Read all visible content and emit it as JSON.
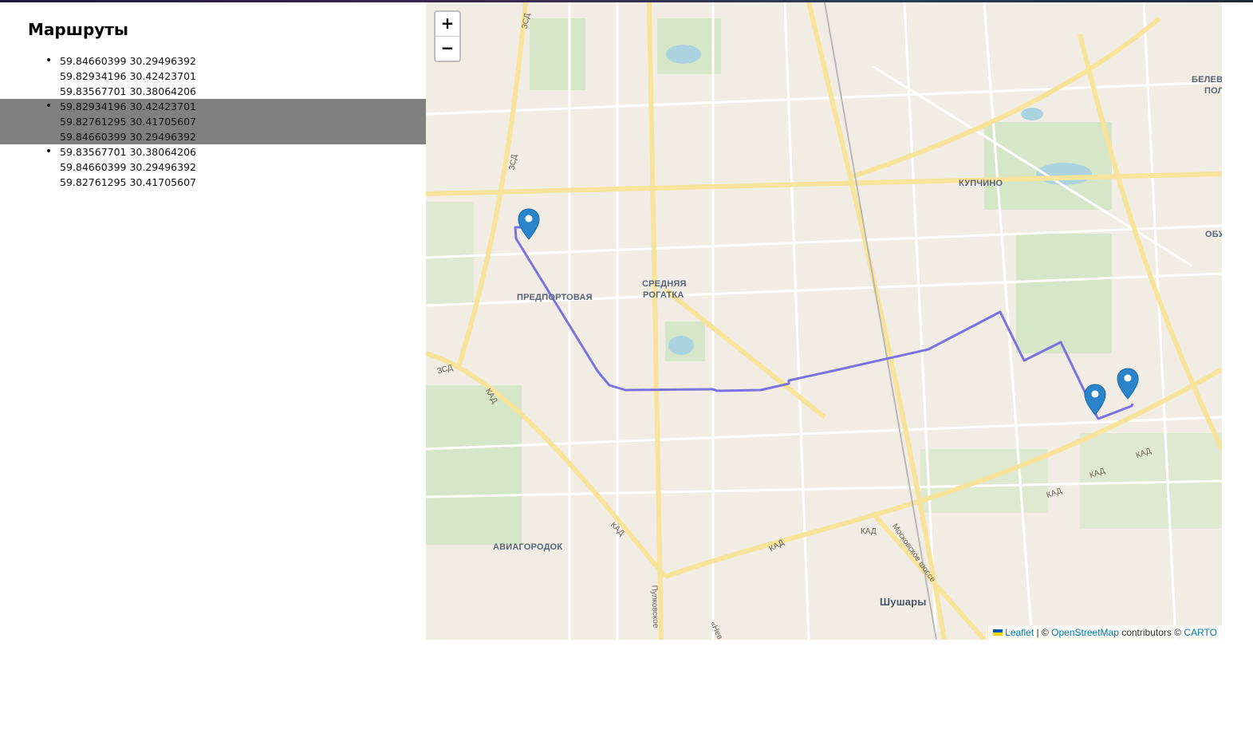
{
  "page": {
    "title": "Маршруты"
  },
  "routes": [
    {
      "points": [
        "59.84660399 30.29496392",
        "59.82934196 30.42423701",
        "59.83567701 30.38064206"
      ],
      "selected": false
    },
    {
      "points": [
        "59.82934196 30.42423701",
        "59.82761295 30.41705607",
        "59.84660399 30.29496392"
      ],
      "selected": true
    },
    {
      "points": [
        "59.83567701 30.38064206",
        "59.84660399 30.29496392",
        "59.82761295 30.41705607"
      ],
      "selected": false
    }
  ],
  "map": {
    "zoom_in": "+",
    "zoom_out": "−",
    "route_color": "#7b72e0",
    "marker_color": "#2a84cb",
    "districts": {
      "kupchino": "КУПЧИНО",
      "predportovaya": "ПРЕДПОРТОВАЯ",
      "srednyaya_rogatka_1": "СРЕДНЯЯ",
      "srednyaya_rogatka_2": "РОГАТКА",
      "aviagorodok": "АВИАГОРОДОК",
      "shushary": "Шушары",
      "belevo_1": "БЕЛЕВС",
      "belevo_2": "ПОЛ",
      "obu": "ОБУ"
    },
    "roads": {
      "zsd": "ЗСД",
      "kad": "КАД",
      "moskovskoe": "Московское шоссе",
      "pulkovskoe": "Пулковское",
      "nev": "«Нев"
    },
    "attribution": {
      "leaflet": "Leaflet",
      "sep": " | © ",
      "osm": "OpenStreetMap",
      "contributors": " contributors © ",
      "carto": "CARTO"
    }
  }
}
